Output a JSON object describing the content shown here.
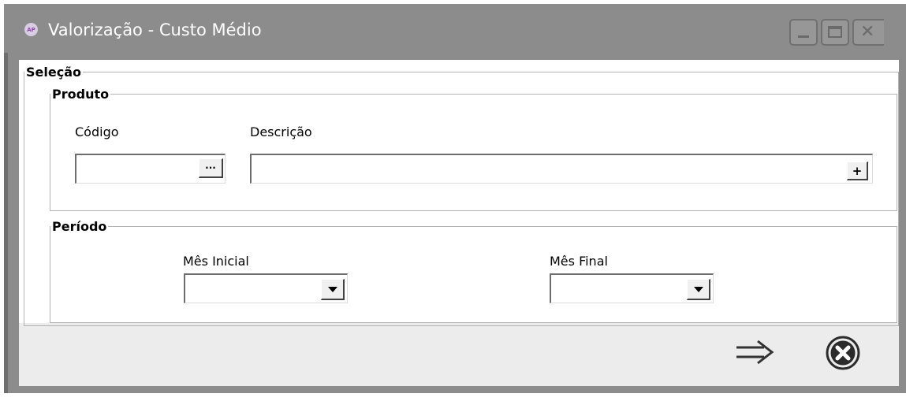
{
  "window": {
    "app_icon_text": "AP",
    "title": "Valorização - Custo Médio",
    "buttons": {
      "minimize": "minimize",
      "maximize": "maximize",
      "close": "close"
    }
  },
  "selecao": {
    "legend": "Seleção",
    "produto": {
      "legend": "Produto",
      "codigo_label": "Código",
      "codigo_value": "",
      "codigo_lookup_label": "···",
      "descricao_label": "Descrição",
      "descricao_value": "",
      "descricao_add_label": "+"
    },
    "periodo": {
      "legend": "Período",
      "mes_inicial_label": "Mês Inicial",
      "mes_inicial_value": "",
      "mes_final_label": "Mês Final",
      "mes_final_value": ""
    }
  },
  "actions": {
    "confirm_icon": "arrow-right-icon",
    "cancel_icon": "close-circle-icon"
  }
}
